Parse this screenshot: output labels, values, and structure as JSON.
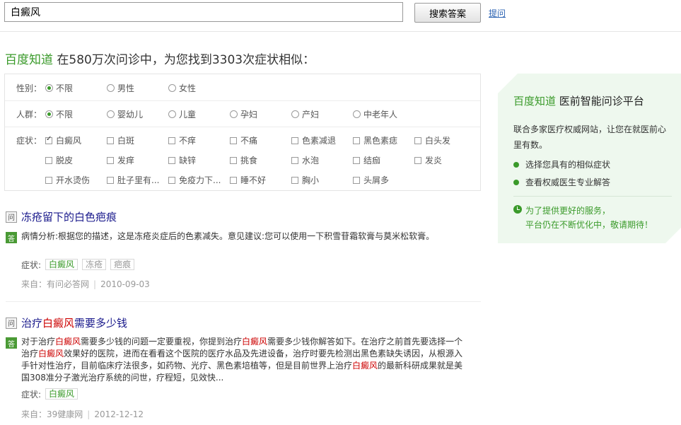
{
  "search": {
    "value": "白癜风",
    "button": "搜索答案",
    "ask": "提问"
  },
  "headline": {
    "brand": "百度知道",
    "text": " 在580万次问诊中，为您找到3303次症状相似："
  },
  "filters": {
    "gender": {
      "label": "性别：",
      "options": [
        "不限",
        "男性",
        "女性"
      ],
      "selected": 0
    },
    "crowd": {
      "label": "人群：",
      "options": [
        "不限",
        "婴幼儿",
        "儿童",
        "孕妇",
        "产妇",
        "中老年人"
      ],
      "selected": 0
    },
    "symptom": {
      "label": "症状：",
      "options": [
        "白癜风",
        "白斑",
        "不痒",
        "不痛",
        "色素减退",
        "黑色素痣",
        "白头发",
        "脱皮",
        "发痒",
        "缺锌",
        "挑食",
        "水泡",
        "结痂",
        "发炎",
        "开水烫伤",
        "肚子里有...",
        "免疫力下...",
        "睡不好",
        "胸小",
        "头屑多"
      ],
      "checked": [
        0
      ]
    }
  },
  "results": [
    {
      "q_tag": "问",
      "a_tag": "答",
      "title": [
        {
          "t": "冻疮留下的白色疤痕",
          "hl": false
        }
      ],
      "body": [
        {
          "t": "病情分析:根据您的描述，这是冻疮炎症后的色素减失。意见建议:您可以使用一下积雪苷霜软膏与莫米松软膏。",
          "hl": false
        }
      ],
      "symptom_label": "症状:",
      "symptoms": [
        {
          "t": "白癜风",
          "c": "green"
        },
        {
          "t": "冻疮",
          "c": "gray"
        },
        {
          "t": "疤痕",
          "c": "gray"
        }
      ],
      "source_label": "来自：有问必答网",
      "date": "2010-09-03"
    },
    {
      "q_tag": "问",
      "a_tag": "答",
      "title": [
        {
          "t": "治疗",
          "hl": false
        },
        {
          "t": "白癜风",
          "hl": true
        },
        {
          "t": "需要多少钱",
          "hl": false
        }
      ],
      "body": [
        {
          "t": "对于治疗",
          "hl": false
        },
        {
          "t": "白癜风",
          "hl": true
        },
        {
          "t": "需要多少钱的问题一定要重视，你提到治疗",
          "hl": false
        },
        {
          "t": "白癜风",
          "hl": true
        },
        {
          "t": "需要多少钱你解答如下。在治疗之前首先要选择一个治疗",
          "hl": false
        },
        {
          "t": "白癜风",
          "hl": true
        },
        {
          "t": "效果好的医院，进而在看看这个医院的医疗水品及先进设备，治疗时要先检测出黑色素缺失诱因，从根源入手针对性治疗，目前临床疗法很多，如药物、光疗、黑色素培植等，但是目前世界上治疗",
          "hl": false
        },
        {
          "t": "白癜风",
          "hl": true
        },
        {
          "t": "的最新科研成果就是美国308准分子激光治疗系统的问世，疗程短，见效快...",
          "hl": false
        }
      ],
      "symptom_label": "症状:",
      "symptoms": [
        {
          "t": "白癜风",
          "c": "green"
        }
      ],
      "source_label": "来自：39健康网",
      "date": "2012-12-12"
    }
  ],
  "panel": {
    "brand": "百度知道",
    "title": " 医前智能问诊平台",
    "desc": "联合多家医疗权威网站，让您在就医前心里有数。",
    "features": [
      "选择您具有的相似症状",
      "查看权威医生专业解答"
    ],
    "note": [
      "为了提供更好的服务，",
      "平台仍在不断优化中，敬请期待！"
    ]
  },
  "colors": {
    "brand_green": "#3a9a2a",
    "highlight_red": "#cc0000",
    "title_blue": "#1a1a8c"
  }
}
